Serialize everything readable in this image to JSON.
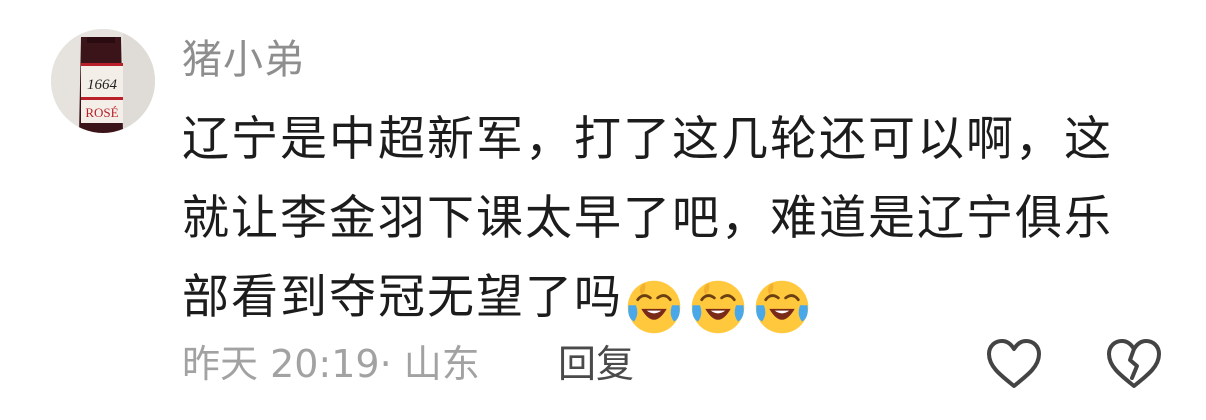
{
  "comment": {
    "username": "猪小弟",
    "avatar": {
      "icon": "wine-bottle-avatar",
      "logo_text_1": "1664",
      "logo_text_2": "ROSÉ"
    },
    "text_lines": [
      "辽宁是中超新军，打了这几轮还可以啊，这",
      "就让李金羽下课太早了吧，难道是辽宁俱乐",
      "部看到夺冠无望了吗"
    ],
    "emojis": [
      "laugh-cry-emoji",
      "laugh-cry-emoji",
      "laugh-cry-emoji"
    ],
    "meta": "昨天 20:19· 山东",
    "reply_label": "回复",
    "actions": {
      "like_icon": "heart-outline-icon",
      "dislike_icon": "broken-heart-outline-icon"
    }
  },
  "colors": {
    "username": "#8e8e8e",
    "text": "#1c1c1c",
    "meta": "#a2a2a2",
    "reply": "#4a4a4a",
    "emoji_face": "#ffc83d",
    "emoji_tear": "#49a8ea"
  }
}
